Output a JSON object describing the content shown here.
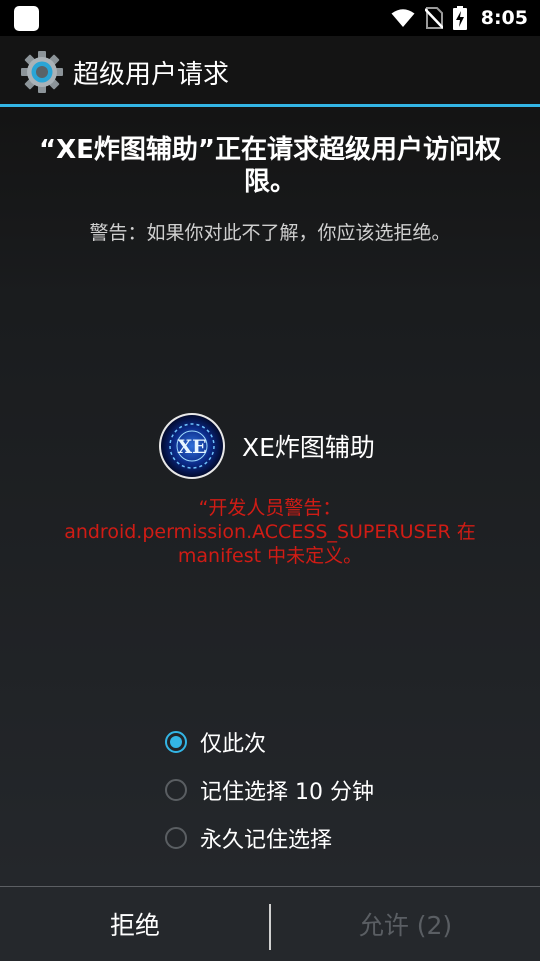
{
  "status_bar": {
    "time": "8:05"
  },
  "title_bar": {
    "title": "超级用户请求"
  },
  "request": {
    "headline": "“XE炸图辅助”正在请求超级用户访问权限。",
    "warning": "警告：如果你对此不了解，你应该选拒绝。"
  },
  "app": {
    "name": "XE炸图辅助",
    "logo_text": "XE"
  },
  "developer_warning": {
    "line1": "“开发人员警告：",
    "line2": "android.permission.ACCESS_SUPERUSER 在",
    "line3": "manifest 中未定义。"
  },
  "options": [
    {
      "label": "仅此次",
      "selected": true
    },
    {
      "label": "记住选择 10 分钟",
      "selected": false
    },
    {
      "label": "永久记住选择",
      "selected": false
    }
  ],
  "buttons": {
    "deny": "拒绝",
    "allow": "允许 (2)"
  },
  "colors": {
    "accent": "#33b5e5",
    "dev_warning": "#d01c15",
    "disabled_text": "#5a5e63"
  }
}
